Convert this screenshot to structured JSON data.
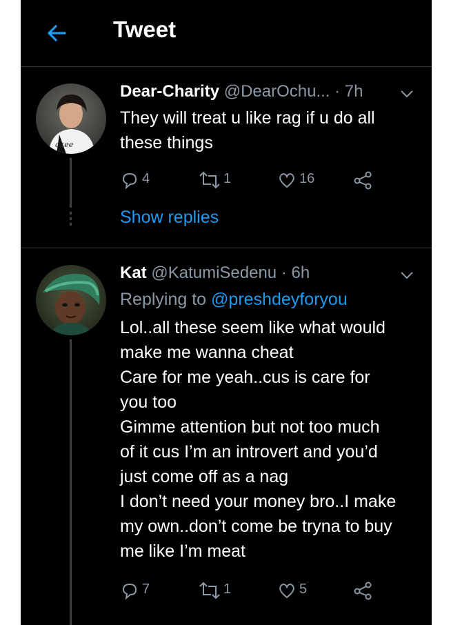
{
  "header": {
    "title": "Tweet",
    "back_icon": "arrow-left-icon",
    "accent": "#1d9bf0"
  },
  "tweets": [
    {
      "name": "Dear-Charity",
      "handle": "@DearOchu...",
      "time": "· 7h",
      "lines": [
        "They will treat u like rag if u do all",
        "these things"
      ],
      "replies": "4",
      "retweets": "1",
      "likes": "16",
      "show_replies": "Show replies"
    },
    {
      "name": "Kat",
      "handle": "@KatumiSedenu",
      "time": "· 6h",
      "replying_prefix": "Replying to",
      "replying_to": "@preshdeyforyou",
      "lines": [
        "Lol..all these seem like what would",
        "make me wanna cheat",
        "Care for me yeah..cus is care for",
        "you too",
        "Gimme attention but not too much",
        "of it cus I’m an introvert and you’d",
        "just come off as a nag",
        "I don’t need your money bro..I make",
        "my own..don’t come be tryna to buy",
        "me like I’m meat"
      ],
      "replies": "7",
      "retweets": "1",
      "likes": "5"
    }
  ]
}
